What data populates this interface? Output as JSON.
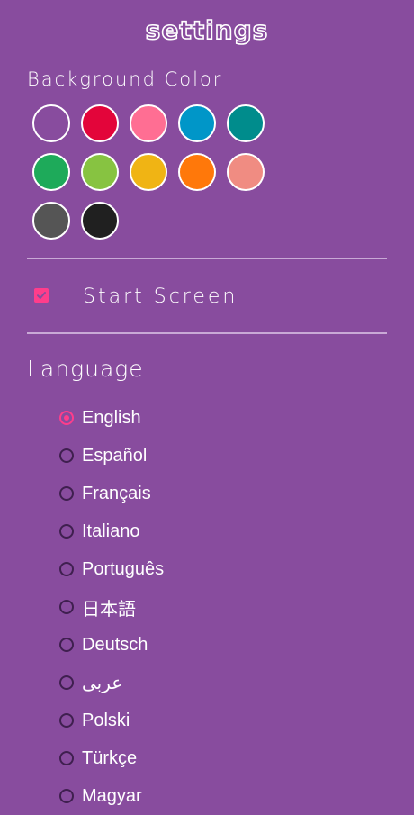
{
  "header": {
    "title": "settings"
  },
  "background": {
    "label": "Background Color",
    "selected": 0,
    "swatches": [
      {
        "name": "purple",
        "color": "#884c9e"
      },
      {
        "name": "red",
        "color": "#e3053a"
      },
      {
        "name": "pink",
        "color": "#ff6e93"
      },
      {
        "name": "blue",
        "color": "#0096c8"
      },
      {
        "name": "teal",
        "color": "#008c8c"
      },
      {
        "name": "green",
        "color": "#1eaa5a"
      },
      {
        "name": "lime",
        "color": "#87c341"
      },
      {
        "name": "yellow",
        "color": "#f0b414"
      },
      {
        "name": "orange",
        "color": "#ff780a"
      },
      {
        "name": "salmon",
        "color": "#f08c82"
      },
      {
        "name": "gray",
        "color": "#555555"
      },
      {
        "name": "black",
        "color": "#202020"
      }
    ]
  },
  "start_screen": {
    "label": "Start Screen",
    "checked": true,
    "icon": "check-icon"
  },
  "language": {
    "label": "Language",
    "selected": "English",
    "options": [
      "English",
      "Español",
      "Français",
      "Italiano",
      "Português",
      "日本語",
      "Deutsch",
      "عربى",
      "Polski",
      "Türkçe",
      "Magyar"
    ]
  },
  "colors": {
    "accent": "#ff3d8b",
    "background": "#884c9e"
  }
}
